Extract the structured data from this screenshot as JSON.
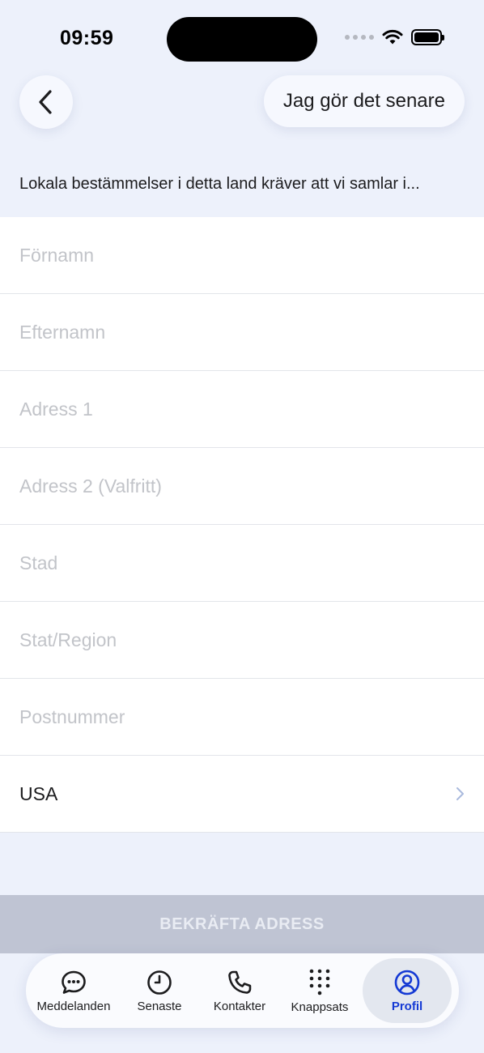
{
  "status_bar": {
    "time": "09:59"
  },
  "header": {
    "later_label": "Jag gör det senare"
  },
  "notice": "Lokala bestämmelser i detta land kräver att vi samlar i...",
  "form": {
    "first_name_placeholder": "Förnamn",
    "last_name_placeholder": "Efternamn",
    "address1_placeholder": "Adress 1",
    "address2_placeholder": "Adress 2 (Valfritt)",
    "city_placeholder": "Stad",
    "state_placeholder": "Stat/Region",
    "zip_placeholder": "Postnummer",
    "country_value": "USA"
  },
  "confirm_label": "BEKRÄFTA ADRESS",
  "tabbar": {
    "items": [
      {
        "label": "Meddelanden",
        "icon": "chat-bubble-icon"
      },
      {
        "label": "Senaste",
        "icon": "clock-icon"
      },
      {
        "label": "Kontakter",
        "icon": "phone-icon"
      },
      {
        "label": "Knappsats",
        "icon": "keypad-icon"
      },
      {
        "label": "Profil",
        "icon": "profile-icon",
        "active": true
      }
    ]
  },
  "colors": {
    "background": "#edf1fb",
    "active_tab": "#1439d4",
    "confirm_disabled": "#bfc4d3",
    "chevron": "#a9b9dd"
  }
}
